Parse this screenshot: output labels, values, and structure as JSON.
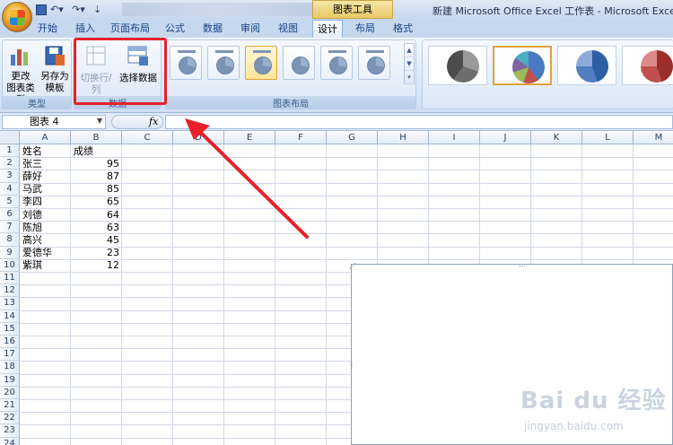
{
  "titlebar": {
    "chart_tools": "图表工具",
    "window_title": "新建 Microsoft Office Excel 工作表 - Microsoft Excel"
  },
  "tabs": [
    "开始",
    "插入",
    "页面布局",
    "公式",
    "数据",
    "审阅",
    "视图",
    "设计",
    "布局",
    "格式"
  ],
  "active_tab": "设计",
  "ribbon": {
    "type_group": {
      "label": "类型",
      "change_type": "更改\n图表类型",
      "change_type_l1": "更改",
      "change_type_l2": "图表类型",
      "save_template_l1": "另存为",
      "save_template_l2": "模板"
    },
    "data_group": {
      "label": "数据",
      "switch_row_col": "切换行/列",
      "select_data": "选择数据"
    },
    "layout_group": {
      "label": "图表布局"
    }
  },
  "formula_bar": {
    "name_box": "图表 4",
    "fx": "fx",
    "formula": ""
  },
  "columns": [
    "A",
    "B",
    "C",
    "D",
    "E",
    "F",
    "G",
    "H",
    "I",
    "J",
    "K",
    "L",
    "M"
  ],
  "rows": [
    "1",
    "2",
    "3",
    "4",
    "5",
    "6",
    "7",
    "8",
    "9",
    "10",
    "11",
    "12",
    "13",
    "14",
    "15",
    "16",
    "17",
    "18",
    "19",
    "20",
    "21",
    "22",
    "23",
    "24"
  ],
  "sheet": {
    "header": {
      "name": "姓名",
      "score": "成绩"
    },
    "records": [
      {
        "name": "张三",
        "score": "95"
      },
      {
        "name": "薛好",
        "score": "87"
      },
      {
        "name": "马武",
        "score": "85"
      },
      {
        "name": "李四",
        "score": "65"
      },
      {
        "name": "刘德",
        "score": "64"
      },
      {
        "name": "陈旭",
        "score": "63"
      },
      {
        "name": "高兴",
        "score": "45"
      },
      {
        "name": "爱德华",
        "score": "23"
      },
      {
        "name": "紫琪",
        "score": "12"
      }
    ]
  },
  "watermark": {
    "main": "Bai du 经验",
    "sub": "jingyan.baidu.com"
  },
  "colors": {
    "highlight": "#e8202a",
    "ribbon_bg": "#dae7f6",
    "active_tab_text": "#000000"
  }
}
